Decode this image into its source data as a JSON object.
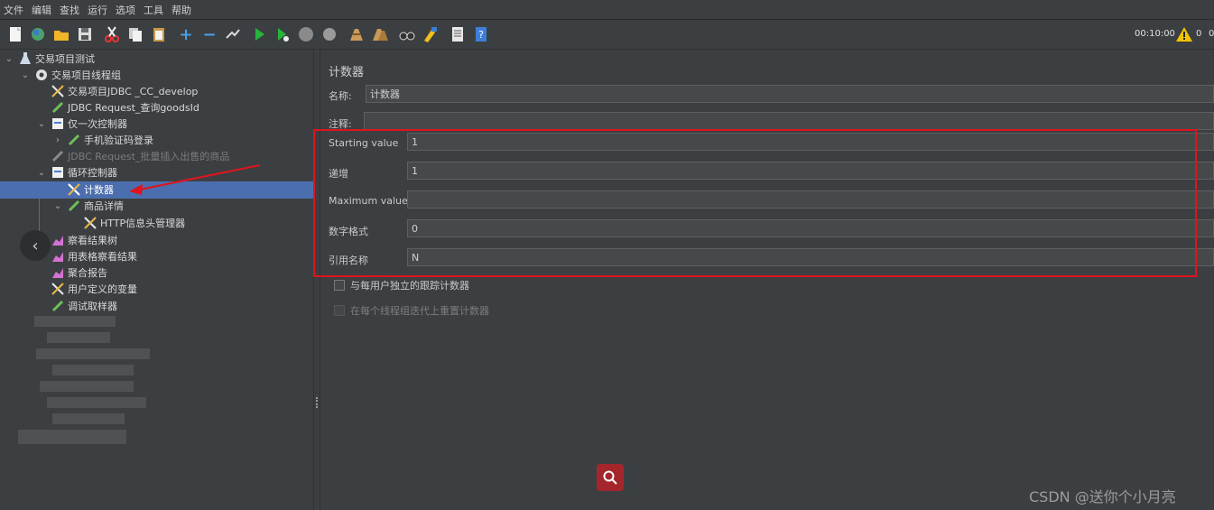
{
  "menu": [
    "文件",
    "编辑",
    "查找",
    "运行",
    "选项",
    "工具",
    "帮助"
  ],
  "toolbar": {
    "timer": "00:10:00",
    "warning_count": "0",
    "active_count": "0"
  },
  "tree": {
    "items": [
      {
        "label": "交易项目测试"
      },
      {
        "label": "交易项目线程组"
      },
      {
        "label": "交易项目JDBC _CC_develop"
      },
      {
        "label": "JDBC Request_查询goodsId"
      },
      {
        "label": "仅一次控制器"
      },
      {
        "label": "手机验证码登录"
      },
      {
        "label": "JDBC Request_批量插入出售的商品"
      },
      {
        "label": "循环控制器"
      },
      {
        "label": "计数器"
      },
      {
        "label": "商品详情"
      },
      {
        "label": "HTTP信息头管理器"
      },
      {
        "label": "察看结果树"
      },
      {
        "label": "用表格察看结果"
      },
      {
        "label": "聚合报告"
      },
      {
        "label": "用户定义的变量"
      },
      {
        "label": "调试取样器"
      }
    ]
  },
  "panel": {
    "title": "计数器",
    "name_label": "名称:",
    "name_value": "计数器",
    "comment_label": "注释:",
    "comment_value": "",
    "fields": [
      {
        "label": "Starting value",
        "value": "1"
      },
      {
        "label": "递增",
        "value": "1"
      },
      {
        "label": "Maximum value",
        "value": ""
      },
      {
        "label": "数字格式",
        "value": "0"
      },
      {
        "label": "引用名称",
        "value": "N"
      }
    ],
    "checkbox1": "与每用户独立的跟踪计数器",
    "checkbox2": "在每个线程组迭代上重置计数器"
  },
  "watermark": "CSDN @送你个小月亮",
  "colors": {
    "selection": "#4b6eaf",
    "highlight_box": "#e0141c",
    "search_button": "#a4262c"
  }
}
